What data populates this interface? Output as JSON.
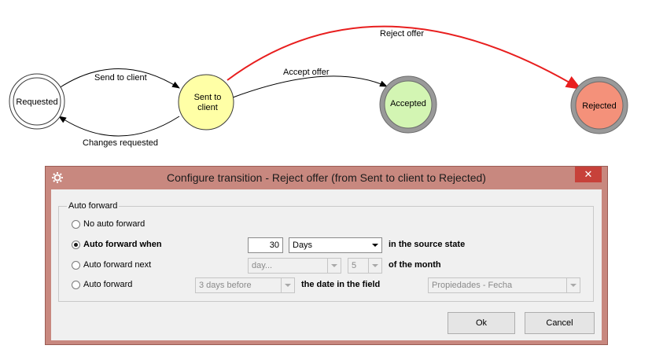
{
  "diagram": {
    "states": [
      {
        "id": "requested",
        "label": "Requested"
      },
      {
        "id": "sent",
        "label_line1": "Sent to",
        "label_line2": "client"
      },
      {
        "id": "accepted",
        "label": "Accepted"
      },
      {
        "id": "rejected",
        "label": "Rejected"
      }
    ],
    "transitions": {
      "send_to_client": "Send to client",
      "changes_requested": "Changes requested",
      "accept_offer": "Accept offer",
      "reject_offer": "Reject offer"
    },
    "colors": {
      "sent_fill": "#ffffa6",
      "accepted_fill": "#d3f5b3",
      "rejected_fill": "#f4917a",
      "highlight_edge": "#e81e1e"
    }
  },
  "dialog": {
    "title": "Configure transition - Reject offer (from Sent to client to Rejected)",
    "close_glyph": "✕",
    "group_label": "Auto forward",
    "options": {
      "none": "No auto forward",
      "when": "Auto forward when",
      "next": "Auto forward next",
      "field": "Auto forward"
    },
    "selected_option": "when",
    "when_value": "30",
    "when_unit": "Days",
    "when_suffix": "in the source state",
    "next_day": "day...",
    "next_num": "5",
    "next_suffix": "of the month",
    "field_offset": "3 days before",
    "field_middle": "the date in the field",
    "field_name": "Propiedades - Fecha",
    "ok_label": "Ok",
    "cancel_label": "Cancel"
  }
}
